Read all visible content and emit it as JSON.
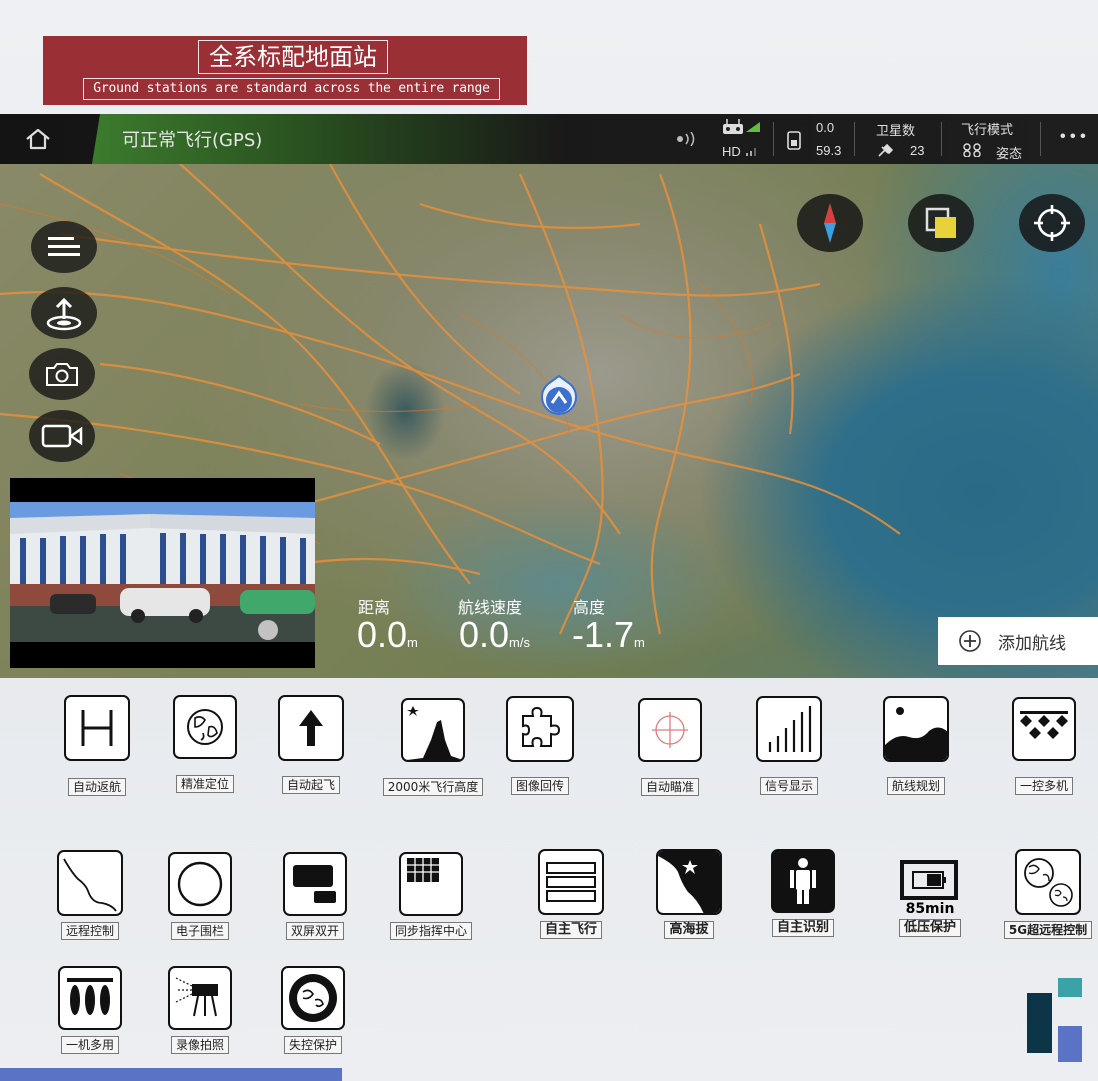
{
  "banner": {
    "title_cn": "全系标配地面站",
    "title_en": "Ground stations are standard across the entire range"
  },
  "topbar": {
    "status": "可正常飞行(GPS)",
    "hd_label": "HD",
    "battery_top": "0.0",
    "battery_bottom": "59.3",
    "satellite_label": "卫星数",
    "satellite_count": "23",
    "flight_mode_label": "飞行模式",
    "flight_mode_value": "姿态",
    "more": "• • •"
  },
  "telemetry": {
    "distance_label": "距离",
    "distance_value": "0.0",
    "distance_unit": "m",
    "speed_label": "航线速度",
    "speed_value": "0.0",
    "speed_unit": "m/s",
    "altitude_label": "高度",
    "altitude_value": "-1.7",
    "altitude_unit": "m"
  },
  "add_route": "添加航线",
  "features": [
    {
      "label": "自动返航",
      "icon": "h-pad-icon"
    },
    {
      "label": "精准定位",
      "icon": "globe-icon"
    },
    {
      "label": "自动起飞",
      "icon": "arrow-up-icon"
    },
    {
      "label": "2000米飞行高度",
      "icon": "altitude-icon"
    },
    {
      "label": "图像回传",
      "icon": "puzzle-icon"
    },
    {
      "label": "自动瞄准",
      "icon": "crosshair-icon"
    },
    {
      "label": "信号显示",
      "icon": "signal-bars-icon"
    },
    {
      "label": "航线规划",
      "icon": "landscape-icon"
    },
    {
      "label": "一控多机",
      "icon": "multi-drone-icon"
    },
    {
      "label": "远程控制",
      "icon": "route-curve-icon"
    },
    {
      "label": "电子围栏",
      "icon": "circle-fence-icon"
    },
    {
      "label": "双屏双开",
      "icon": "dual-screen-icon"
    },
    {
      "label": "同步指挥中心",
      "icon": "grid-screen-icon"
    },
    {
      "label": "自主飞行",
      "icon": "layers-icon"
    },
    {
      "label": "高海拔",
      "icon": "mountain-icon"
    },
    {
      "label": "自主识别",
      "icon": "person-icon"
    },
    {
      "label": "低压保护",
      "icon": "battery-icon",
      "caption": "85min"
    },
    {
      "label": "5G超远程控制",
      "icon": "twin-globe-icon"
    },
    {
      "label": "一机多用",
      "icon": "payloads-icon"
    },
    {
      "label": "录像拍照",
      "icon": "projector-icon"
    },
    {
      "label": "失控保护",
      "icon": "globe-ring-icon"
    }
  ],
  "colors": {
    "banner": "#9a2f35",
    "topbar": "#1a1a1a",
    "status_green": "#3c7b2d",
    "accent_blue": "#5b73c4",
    "accent_teal": "#3aa3a8",
    "logo_navy": "#0c3548"
  }
}
